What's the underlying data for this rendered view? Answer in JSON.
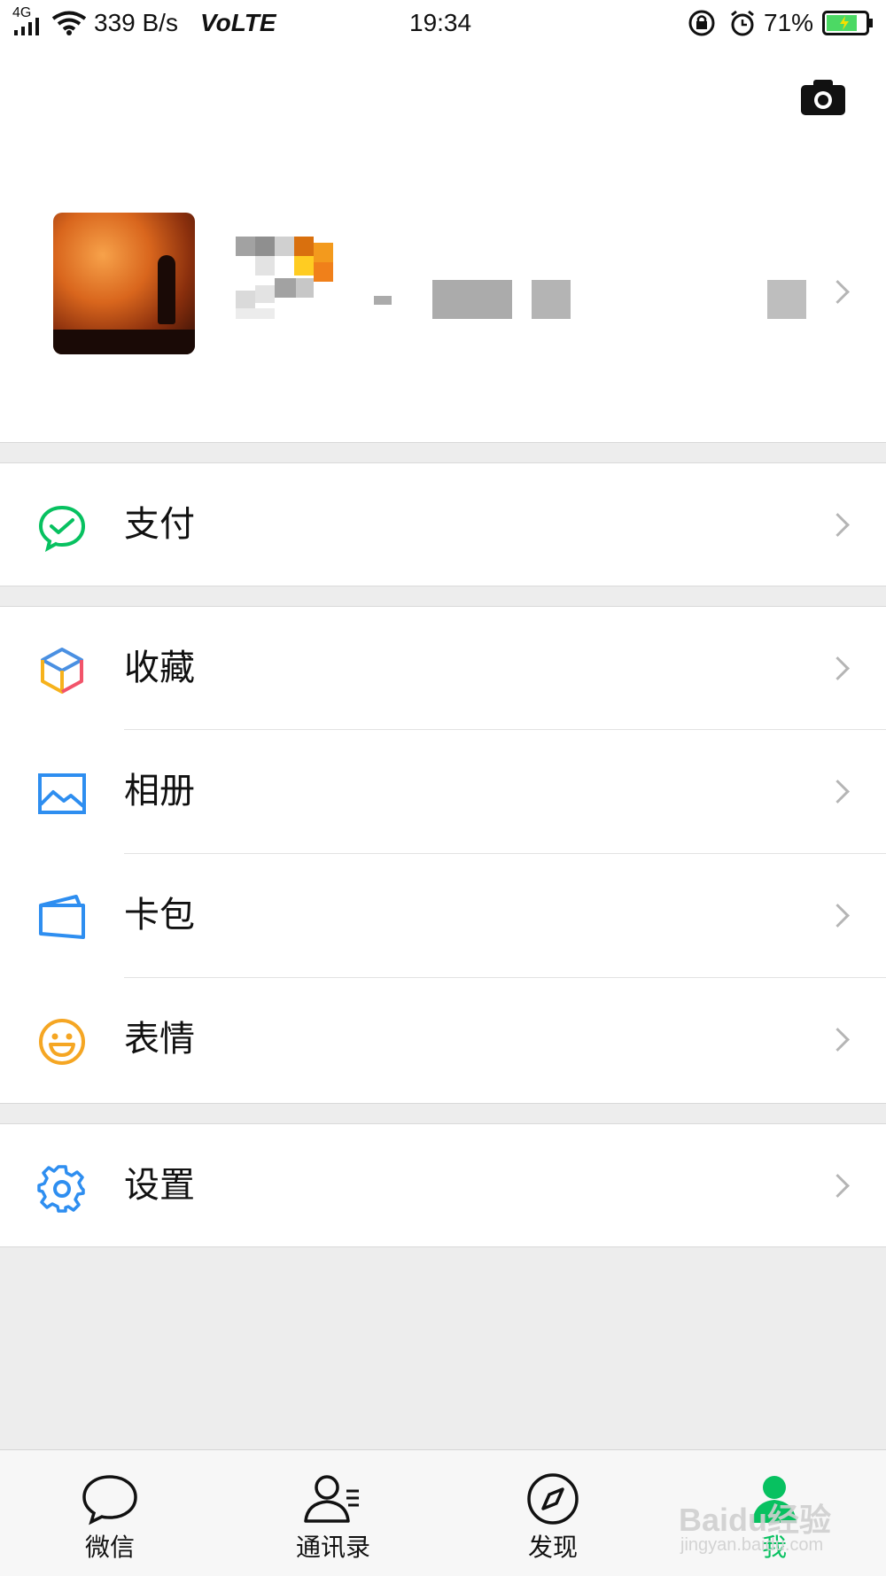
{
  "status_bar": {
    "network": "4G",
    "speed": "339 B/s",
    "volte": "VoLTE",
    "time": "19:34",
    "battery": "71%"
  },
  "header": {
    "camera_icon": "camera-icon"
  },
  "menu": {
    "pay": "支付",
    "favorites": "收藏",
    "album": "相册",
    "cards": "卡包",
    "stickers": "表情",
    "settings": "设置"
  },
  "tabs": [
    {
      "label": "微信",
      "icon": "chat-icon"
    },
    {
      "label": "通讯录",
      "icon": "contacts-icon"
    },
    {
      "label": "发现",
      "icon": "compass-icon"
    },
    {
      "label": "我",
      "icon": "me-icon",
      "active": true
    }
  ],
  "watermark": {
    "logo": "Baidu经验",
    "url": "jingyan.baidu.com"
  },
  "colors": {
    "accent": "#07c160",
    "background": "#ededed",
    "tabbar": "#f7f7f7"
  }
}
